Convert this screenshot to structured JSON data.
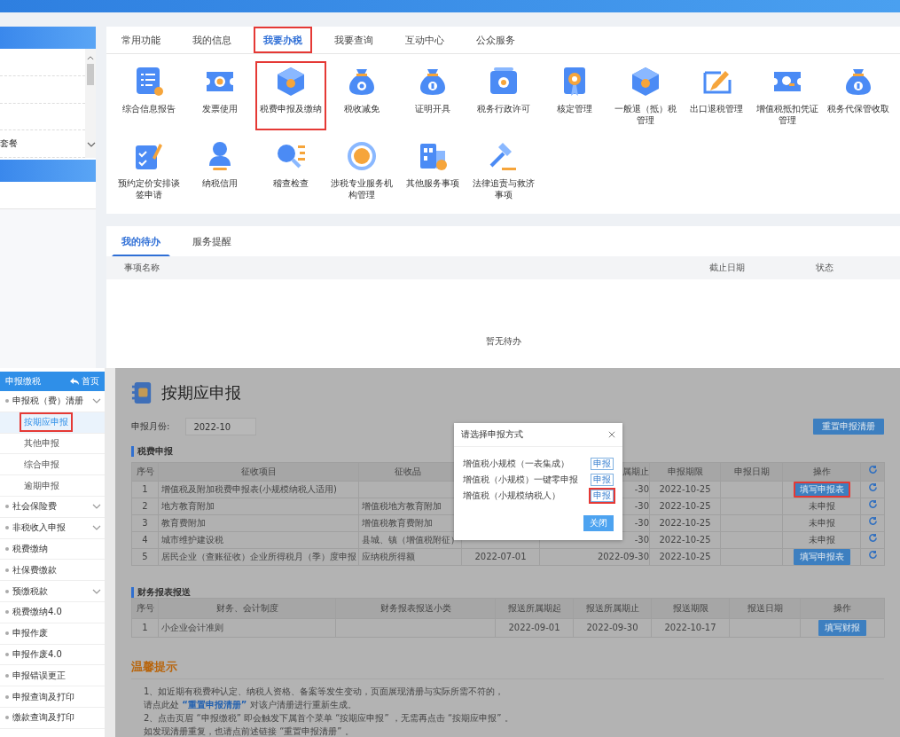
{
  "portal": {
    "left_menu": {
      "items": [
        {
          "selected": false
        },
        {
          "selected": false
        },
        {
          "selected": false
        },
        {
          "label": "套餐",
          "selected": false
        },
        {
          "selected": true
        }
      ]
    },
    "tabs": [
      {
        "label": "常用功能",
        "selected": false,
        "highlighted": false
      },
      {
        "label": "我的信息",
        "selected": false,
        "highlighted": false
      },
      {
        "label": "我要办税",
        "selected": true,
        "highlighted": true
      },
      {
        "label": "我要查询",
        "selected": false,
        "highlighted": false
      },
      {
        "label": "互动中心",
        "selected": false,
        "highlighted": false
      },
      {
        "label": "公众服务",
        "selected": false,
        "highlighted": false
      }
    ],
    "services": [
      {
        "label": "综合信息报告",
        "highlighted": false
      },
      {
        "label": "发票使用",
        "highlighted": false
      },
      {
        "label": "税费申报及缴纳",
        "highlighted": true
      },
      {
        "label": "税收减免",
        "highlighted": false
      },
      {
        "label": "证明开具",
        "highlighted": false
      },
      {
        "label": "税务行政许可",
        "highlighted": false
      },
      {
        "label": "核定管理",
        "highlighted": false
      },
      {
        "label": "一般退（抵）税管理",
        "highlighted": false
      },
      {
        "label": "出口退税管理",
        "highlighted": false
      },
      {
        "label": "增值税抵扣凭证管理",
        "highlighted": false
      },
      {
        "label": "税务代保管收取",
        "highlighted": false
      },
      {
        "label": "预约定价安排谈签申请",
        "highlighted": false
      },
      {
        "label": "纳税信用",
        "highlighted": false
      },
      {
        "label": "稽查检查",
        "highlighted": false
      },
      {
        "label": "涉税专业服务机构管理",
        "highlighted": false
      },
      {
        "label": "其他服务事项",
        "highlighted": false
      },
      {
        "label": "法律追责与救济事项",
        "highlighted": false
      }
    ],
    "todo": {
      "tabs": [
        {
          "label": "我的待办",
          "selected": true
        },
        {
          "label": "服务提醒",
          "selected": false
        }
      ],
      "columns": [
        "事项名称",
        "截止日期",
        "状态"
      ],
      "empty_text": "暂无待办"
    }
  },
  "declaration": {
    "sidebar": {
      "title": "申报缴税",
      "home": "首页",
      "items": [
        {
          "label": "申报税（费）清册",
          "expandable": true,
          "children": [
            {
              "label": "按期应申报",
              "selected": true,
              "highlighted": true
            },
            {
              "label": "其他申报",
              "selected": false,
              "highlighted": false
            },
            {
              "label": "综合申报",
              "selected": false,
              "highlighted": false
            },
            {
              "label": "逾期申报",
              "selected": false,
              "highlighted": false
            }
          ]
        },
        {
          "label": "社会保险费",
          "expandable": true
        },
        {
          "label": "非税收入申报",
          "expandable": true
        },
        {
          "label": "税费缴纳",
          "expandable": false
        },
        {
          "label": "社保费缴款",
          "expandable": false
        },
        {
          "label": "预缴税款",
          "expandable": true
        },
        {
          "label": "税费缴纳4.0",
          "expandable": false
        },
        {
          "label": "申报作废",
          "expandable": false
        },
        {
          "label": "申报作废4.0",
          "expandable": false
        },
        {
          "label": "申报错误更正",
          "expandable": false
        },
        {
          "label": "申报查询及打印",
          "expandable": false
        },
        {
          "label": "缴款查询及打印",
          "expandable": false
        }
      ]
    },
    "title": "按期应申报",
    "month_label": "申报月份:",
    "month_value": "2022-10",
    "reset_button": "重置申报清册",
    "tax_table": {
      "title": "税费申报",
      "columns": {
        "no": "序号",
        "item": "征收项目",
        "category": "征收品",
        "period_end": "属期止",
        "deadline": "申报期限",
        "filed_date": "申报日期",
        "action": "操作"
      },
      "rows": [
        {
          "no": "1",
          "item": "增值税及附加税费申报表(小规模纳税人适用)",
          "period_end": "-30",
          "deadline": "2022-10-25",
          "action": {
            "kind": "button",
            "label": "填写申报表",
            "highlighted": true
          }
        },
        {
          "no": "2",
          "item": "地方教育附加",
          "category": "增值税地方教育附加",
          "period_end": "-30",
          "deadline": "2022-10-25",
          "action": {
            "kind": "text",
            "label": "未申报",
            "highlighted": false
          }
        },
        {
          "no": "3",
          "item": "教育费附加",
          "category": "增值税教育费附加",
          "period_end": "-30",
          "deadline": "2022-10-25",
          "action": {
            "kind": "text",
            "label": "未申报",
            "highlighted": false
          }
        },
        {
          "no": "4",
          "item": "城市维护建设税",
          "category": "县城、镇（增值税附征）",
          "period_end": "-30",
          "deadline": "2022-10-25",
          "action": {
            "kind": "text",
            "label": "未申报",
            "highlighted": false
          }
        },
        {
          "no": "5",
          "item": "居民企业（查账征收）企业所得税月（季）度申报",
          "category": "应纳税所得额",
          "period_start": "2022-07-01",
          "period_end": "2022-09-30",
          "deadline": "2022-10-25",
          "action": {
            "kind": "button",
            "label": "填写申报表",
            "highlighted": false
          }
        }
      ]
    },
    "finance_table": {
      "title": "财务报表报送",
      "columns": {
        "no": "序号",
        "system": "财务、会计制度",
        "subcategory": "财务报表报送小类",
        "start": "报送所属期起",
        "end": "报送所属期止",
        "deadline": "报送期限",
        "date": "报送日期",
        "action": "操作"
      },
      "rows": [
        {
          "no": "1",
          "system": "小企业会计准则",
          "start": "2022-09-01",
          "end": "2022-09-30",
          "deadline": "2022-10-17",
          "action": {
            "kind": "button",
            "label": "填写财报",
            "highlighted": false
          }
        }
      ]
    },
    "tips": {
      "title": "温馨提示",
      "lines": [
        {
          "text": "1、如近期有税费种认定、纳税人资格、备案等发生变动，页面展现清册与实际所需不符的，"
        },
        {
          "text": "请点此处 ",
          "link": "“重置申报清册”",
          "after": " 对该户清册进行重新生成。"
        },
        {
          "text": "2、点击页眉 “申报缴税” 即会触发下属首个菜单 “按期应申报” ，无需再点击 “按期应申报” 。"
        },
        {
          "text": "如发现清册重复，也请点前述链接 “重置申报清册” 。"
        }
      ]
    },
    "modal": {
      "title": "请选择申报方式",
      "options": [
        {
          "label": "增值税小规模（一表集成）",
          "button": "申报",
          "highlighted": false
        },
        {
          "label": "增值税（小规模）一键零申报",
          "button": "申报",
          "highlighted": false
        },
        {
          "label": "增值税（小规模纳税人）",
          "button": "申报",
          "highlighted": true
        }
      ],
      "close_button": "关闭"
    }
  }
}
